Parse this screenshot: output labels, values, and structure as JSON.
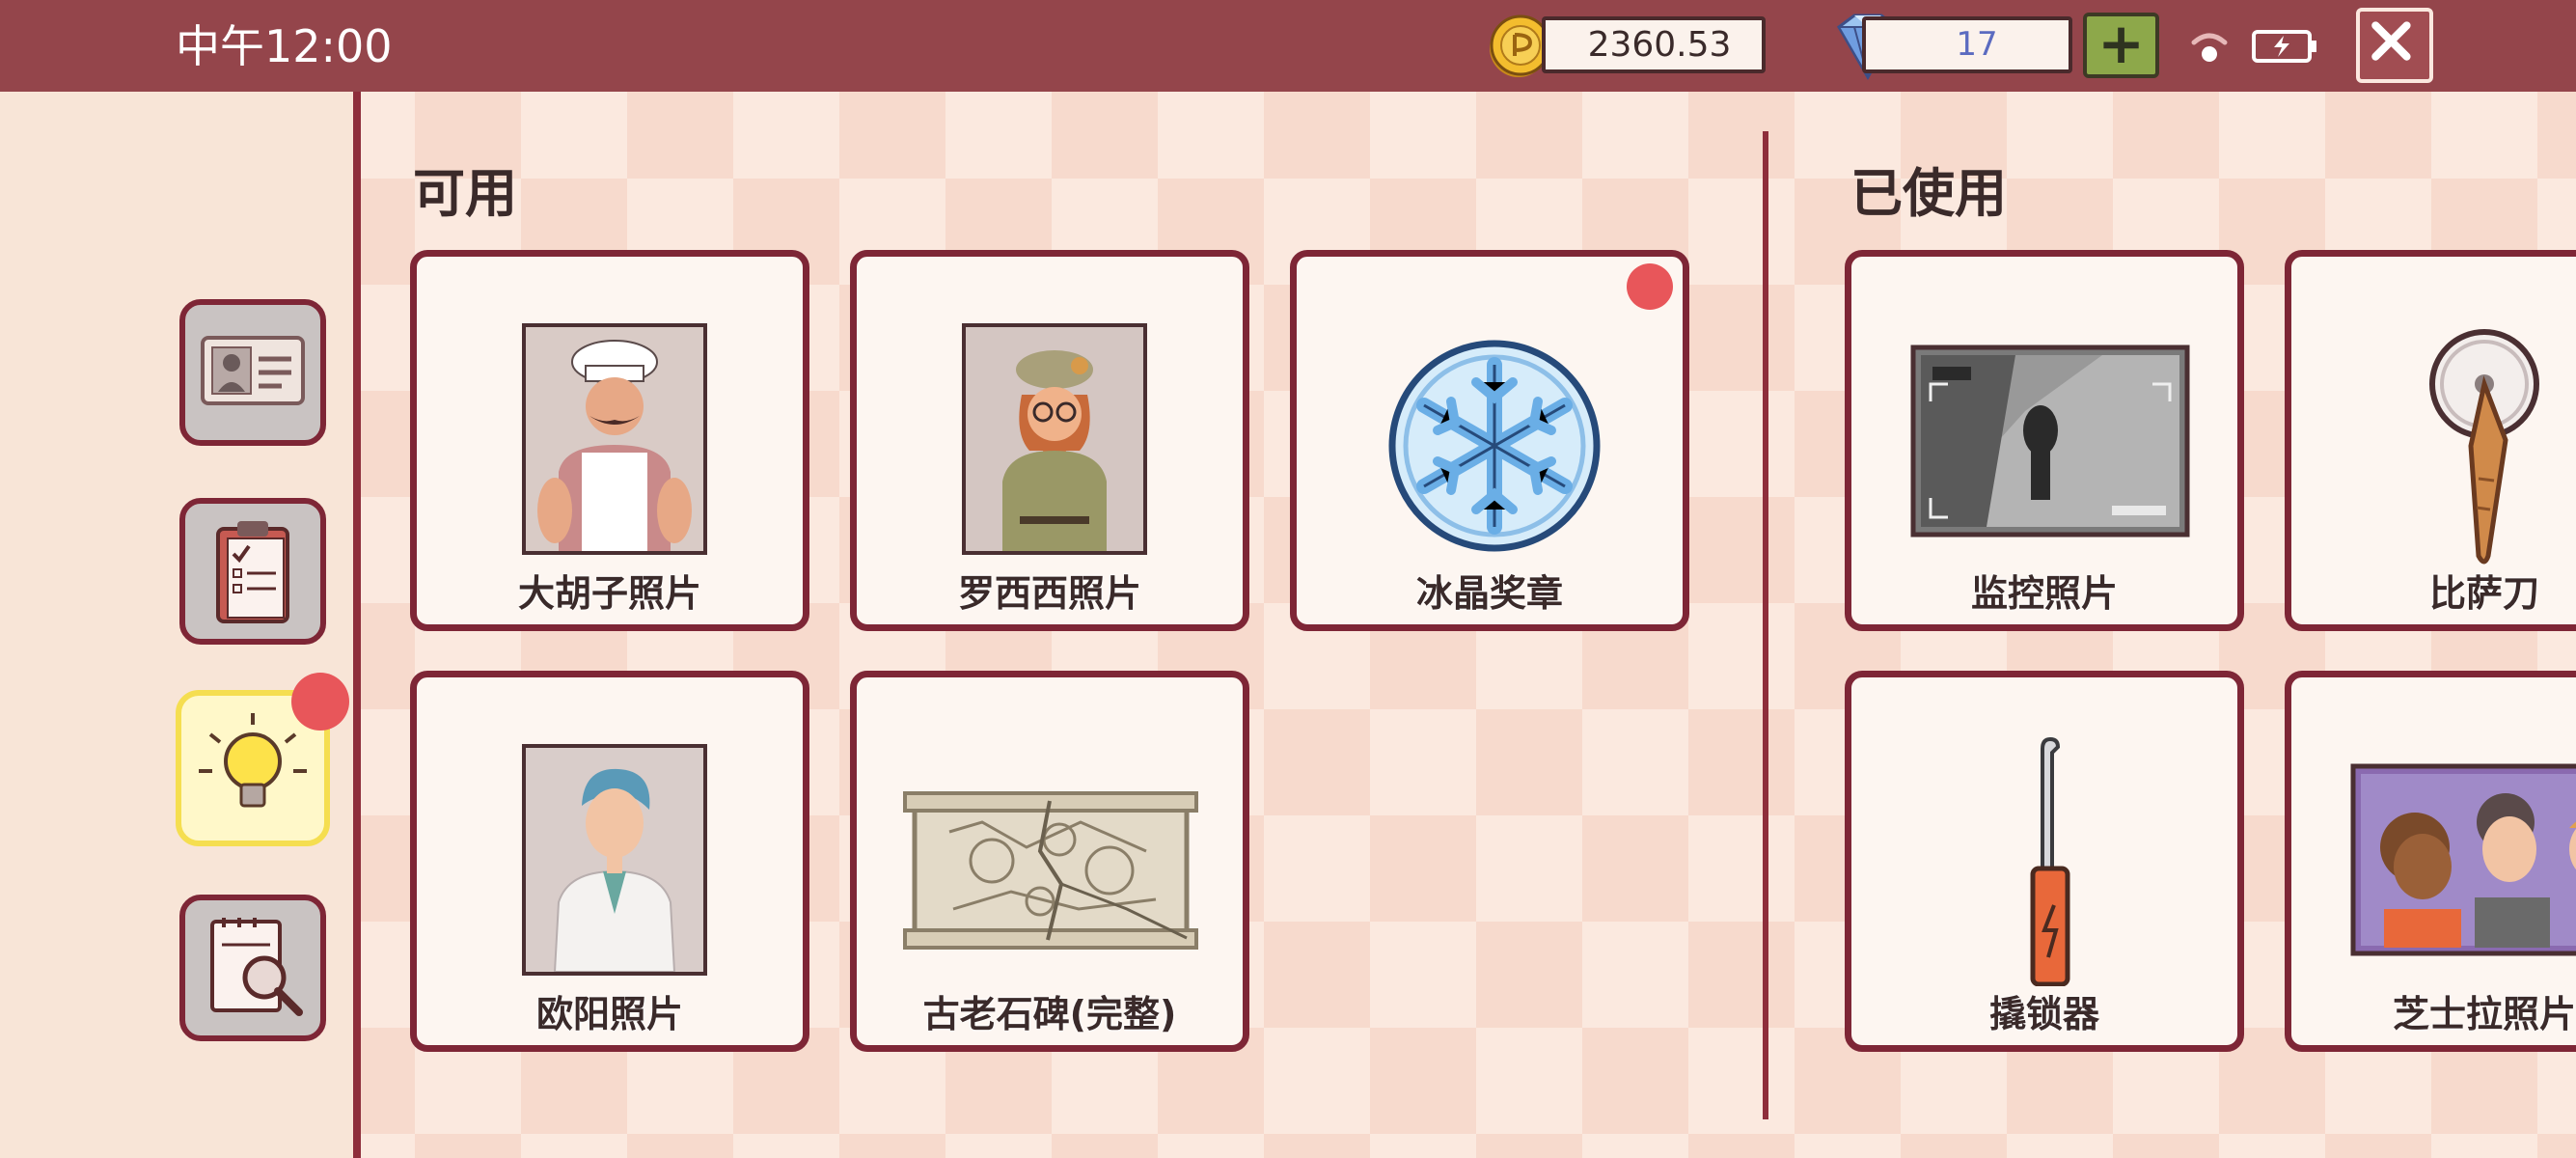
{
  "header": {
    "time": "中午12:00",
    "coins": "2360.53",
    "gems": "17",
    "add_label": "+",
    "close_label": "✕"
  },
  "sidebar": {
    "items": [
      {
        "icon": "id-card-icon"
      },
      {
        "icon": "clipboard-checklist-icon"
      },
      {
        "icon": "lightbulb-icon",
        "active": true,
        "notification": true
      },
      {
        "icon": "notebook-magnifier-icon"
      }
    ]
  },
  "available": {
    "title": "可用",
    "items": [
      {
        "label": "大胡子照片",
        "icon": "chef-photo-icon"
      },
      {
        "label": "罗西西照片",
        "icon": "girl-photo-icon"
      },
      {
        "label": "冰晶奖章",
        "icon": "snowflake-medal-icon",
        "notification": true
      },
      {
        "label": "欧阳照片",
        "icon": "doctor-photo-icon"
      },
      {
        "label": "古老石碑(完整)",
        "icon": "stone-tablet-icon"
      }
    ]
  },
  "used": {
    "title": "已使用",
    "items": [
      {
        "label": "监控照片",
        "icon": "surveillance-photo-icon"
      },
      {
        "label": "比萨刀",
        "icon": "pizza-cutter-icon"
      },
      {
        "label": "撬锁器",
        "icon": "lockpick-icon"
      },
      {
        "label": "芝士拉照片",
        "icon": "group-photo-icon"
      }
    ]
  },
  "colors": {
    "topbar": "#94454b",
    "card_border": "#7e2636",
    "active_border": "#f5de50",
    "notification": "#e8565a"
  }
}
